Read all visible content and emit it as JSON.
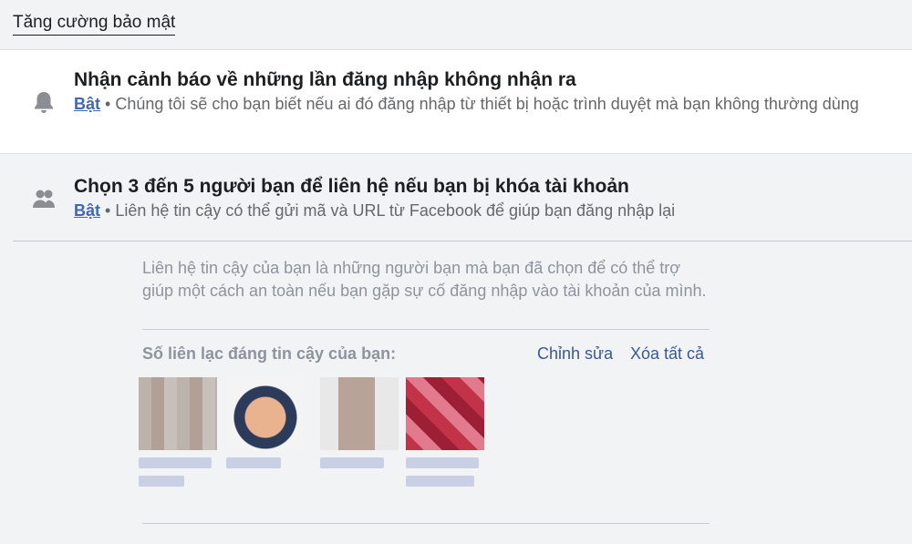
{
  "section": {
    "title": "Tăng cường bảo mật"
  },
  "login_alerts": {
    "title": "Nhận cảnh báo về những lần đăng nhập không nhận ra",
    "status": "Bật",
    "separator": " • ",
    "description": "Chúng tôi sẽ cho bạn biết nếu ai đó đăng nhập từ thiết bị hoặc trình duyệt mà bạn không thường dùng",
    "icon": "bell-icon"
  },
  "trusted_contacts": {
    "title": "Chọn 3 đến 5 người bạn để liên hệ nếu bạn bị khóa tài khoản",
    "status": "Bật",
    "separator": " • ",
    "description": "Liên hệ tin cậy có thể gửi mã và URL từ Facebook để giúp bạn đăng nhập lại",
    "icon": "friends-icon",
    "info": "Liên hệ tin cậy của bạn là những người bạn mà bạn đã chọn để có thể trợ giúp một cách an toàn nếu bạn gặp sự cố đăng nhập vào tài khoản của mình.",
    "contacts_label": "Số liên lạc đáng tin cậy của bạn:",
    "edit_label": "Chỉnh sửa",
    "remove_all_label": "Xóa tất cả"
  },
  "colors": {
    "link": "#4267b2",
    "secondary_text": "#65676b",
    "muted_text": "#8d949e",
    "background": "#f2f3f5"
  }
}
